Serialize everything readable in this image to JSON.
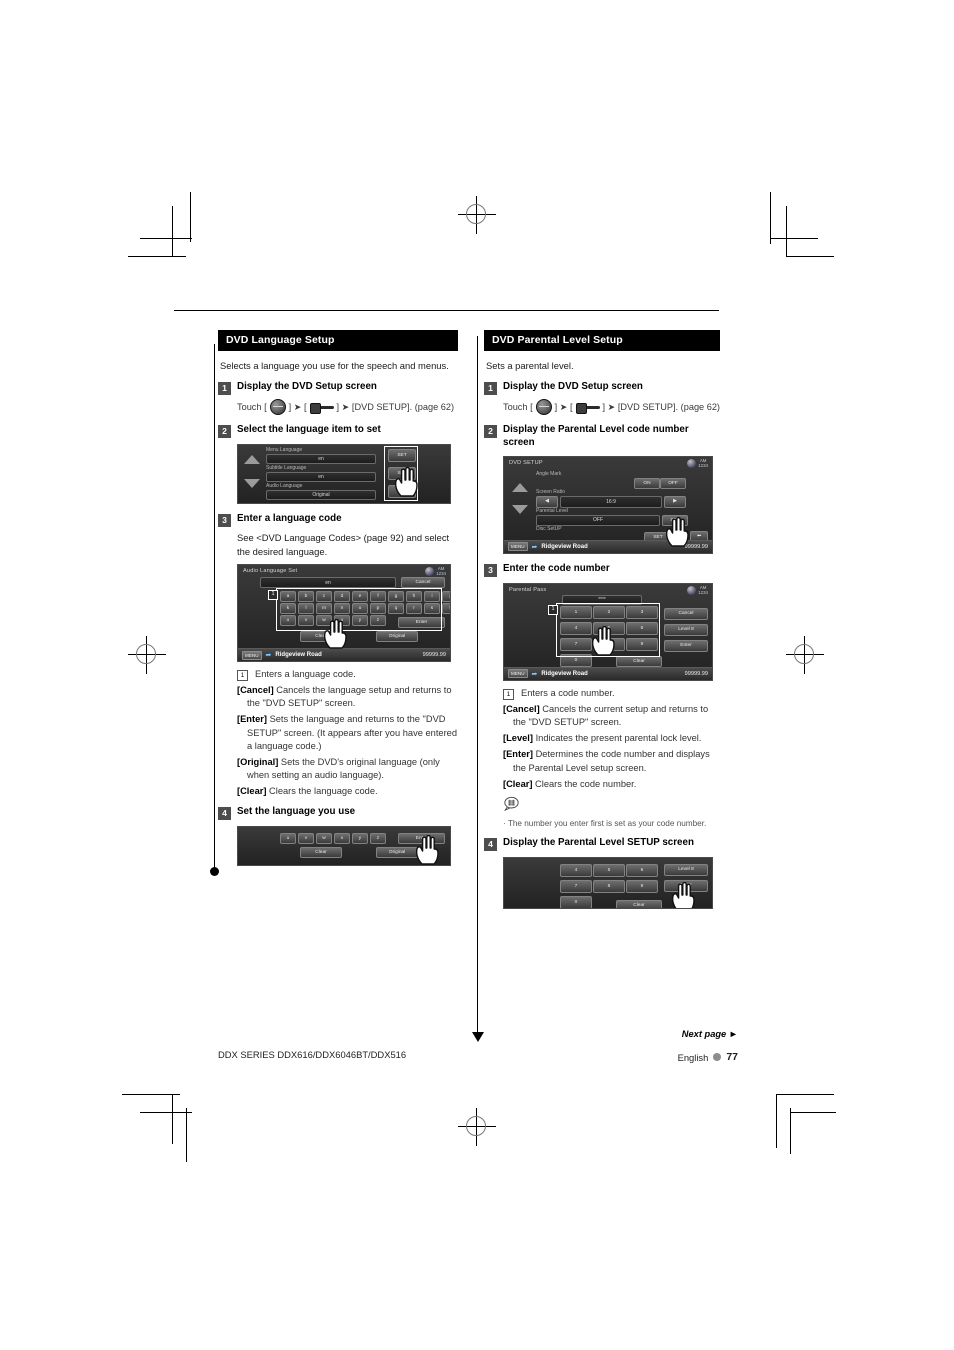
{
  "page": {
    "footer_model": "DDX SERIES   DDX616/DDX6046BT/DDX516",
    "footer_next": "Next page ►",
    "footer_language": "English",
    "footer_page_number": "77"
  },
  "left_column": {
    "section_title": "DVD Language Setup",
    "intro": "Selects a language you use for the speech and menus.",
    "steps": [
      {
        "num": "1",
        "title": "Display the DVD Setup screen",
        "touch_prefix": "Touch [",
        "touch_mid": "] ➤ [",
        "touch_suffix": "] ➤ [DVD SETUP]. (page 62)"
      },
      {
        "num": "2",
        "title": "Select the language item to set"
      },
      {
        "num": "3",
        "title": "Enter a language code",
        "body": "See <DVD Language Codes> (page 92) and select the desired language."
      },
      {
        "num": "4",
        "title": "Set the language you use"
      }
    ],
    "screen_lang_items": {
      "rows": [
        {
          "label": "Menu Language",
          "value": "en",
          "button": "SET"
        },
        {
          "label": "Subtitle Language",
          "value": "en",
          "button": "SET"
        },
        {
          "label": "Audio Language",
          "value": "Original",
          "button": "SET"
        }
      ]
    },
    "screen_audio_set": {
      "title": "Audio Language Set",
      "value": "en",
      "cancel": "Cancel",
      "keys_row1": [
        "a",
        "b",
        "c",
        "d",
        "e",
        "f",
        "g",
        "h",
        "i",
        "j"
      ],
      "keys_row2": [
        "k",
        "l",
        "m",
        "n",
        "o",
        "p",
        "q",
        "r",
        "s",
        "t"
      ],
      "keys_row3": [
        "u",
        "v",
        "w",
        "x",
        "y",
        "z"
      ],
      "enter": "Enter",
      "original": "Original",
      "clear": "Clear",
      "menu": "MENU",
      "track": "Ridgeview Road",
      "freq": "99999.99"
    },
    "screen_step4": {
      "keys": [
        "u",
        "v",
        "w",
        "x",
        "y",
        "z"
      ],
      "enter": "Enter",
      "original": "Original",
      "clear": "Clear"
    },
    "definitions": [
      {
        "callout": "1",
        "text": "Enters a language code."
      },
      {
        "term": "[Cancel]",
        "text": "Cancels the language setup and returns to the \"DVD SETUP\" screen."
      },
      {
        "term": "[Enter]",
        "text": "Sets the language and returns to the \"DVD SETUP\" screen. (It appears after you have entered a language code.)"
      },
      {
        "term": "[Original]",
        "text": "Sets the DVD's original language (only when setting an audio language)."
      },
      {
        "term": "[Clear]",
        "text": "Clears the language code."
      }
    ]
  },
  "right_column": {
    "section_title": "DVD Parental Level Setup",
    "intro": "Sets a parental level.",
    "steps": [
      {
        "num": "1",
        "title": "Display the DVD Setup screen",
        "touch_prefix": "Touch [",
        "touch_mid": "] ➤ [",
        "touch_suffix": "] ➤ [DVD SETUP]. (page 62)"
      },
      {
        "num": "2",
        "title": "Display the Parental Level code number screen"
      },
      {
        "num": "3",
        "title": "Enter the code number"
      },
      {
        "num": "4",
        "title": "Display the Parental Level SETUP screen"
      }
    ],
    "screen_dvd_setup": {
      "title": "DVD SETUP",
      "rows": [
        {
          "label": "Angle Mark",
          "on": "ON",
          "off": "OFF"
        },
        {
          "label": "Screen Ratio",
          "value": "16:9"
        },
        {
          "label": "Parental Level",
          "value": "OFF",
          "button": "SET"
        },
        {
          "label": "Disc SetUP",
          "button": "SET"
        }
      ],
      "menu": "MENU",
      "track": "Ridgeview Road",
      "freq": "99999.99"
    },
    "screen_parental_pass": {
      "title": "Parental Pass",
      "value": "****",
      "keys": [
        "1",
        "2",
        "3",
        "4",
        "5",
        "6",
        "7",
        "8",
        "9",
        "0"
      ],
      "cancel": "Cancel",
      "level": "Level 8",
      "enter": "Enter",
      "clear": "Clear",
      "menu": "MENU",
      "track": "Ridgeview Road",
      "freq": "99999.99"
    },
    "screen_step4": {
      "keys": [
        "4",
        "5",
        "6",
        "7",
        "8",
        "9",
        "0"
      ],
      "level": "Level 8",
      "enter": "Enter",
      "clear": "Clear"
    },
    "definitions": [
      {
        "callout": "1",
        "text": "Enters a code number."
      },
      {
        "term": "[Cancel]",
        "text": "Cancels the current setup and returns to the \"DVD SETUP\" screen."
      },
      {
        "term": "[Level]",
        "text": "Indicates the present parental lock level."
      },
      {
        "term": "[Enter]",
        "text": "Determines the code number and displays the Parental Level setup screen."
      },
      {
        "term": "[Clear]",
        "text": "Clears the code number."
      }
    ],
    "note": "The number you enter first is set as your code number."
  }
}
